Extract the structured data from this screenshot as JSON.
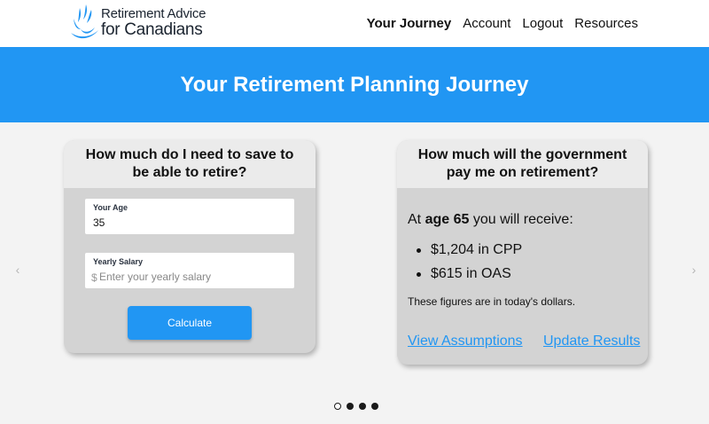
{
  "header": {
    "logo": {
      "line1": "Retirement Advice",
      "line2": "for Canadians",
      "icon": "maple-leaf-swoosh-icon"
    },
    "nav": [
      {
        "label": "Your Journey",
        "active": true
      },
      {
        "label": "Account",
        "active": false
      },
      {
        "label": "Logout",
        "active": false
      },
      {
        "label": "Resources",
        "active": false
      }
    ]
  },
  "banner": {
    "title": "Your Retirement Planning Journey"
  },
  "carousel": {
    "prev_icon": "chevron-left-icon",
    "next_icon": "chevron-right-icon",
    "dots": [
      true,
      false,
      false,
      false
    ]
  },
  "save_card": {
    "title": "How much do I need to save to be able to retire?",
    "age_label": "Your Age",
    "age_value": "35",
    "salary_label": "Yearly Salary",
    "salary_prefix": "$",
    "salary_placeholder": "Enter your yearly salary",
    "salary_value": "",
    "calculate_label": "Calculate"
  },
  "gov_card": {
    "title": "How much will the government pay me on retirement?",
    "intro_prefix": "At",
    "age_text": "age 65",
    "intro_suffix": "you will receive:",
    "benefits": [
      {
        "amount": "$1,204",
        "program": "in CPP"
      },
      {
        "amount": "$615",
        "program": "in OAS"
      }
    ],
    "note": "These figures are in today's dollars.",
    "link_assumptions": "View Assumptions",
    "link_update": "Update Results"
  },
  "colors": {
    "accent": "#2196f3",
    "card_body": "#d3d3d3",
    "card_header": "#ebebeb",
    "page_bg": "#f3f3f3"
  }
}
